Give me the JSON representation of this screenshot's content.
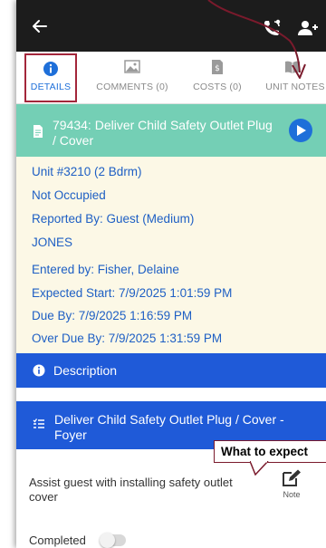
{
  "colors": {
    "topbar": "#1c1c1c",
    "accent_blue": "#1e6fd9",
    "header_teal": "#74cfb5",
    "details_bg": "#fcf8e6",
    "section_blue": "#1f5ad8",
    "annotation": "#7a1a2c"
  },
  "topbar": {
    "back_icon": "arrow-left-icon",
    "call_icon": "phone-call-icon",
    "add_person_icon": "person-add-icon"
  },
  "tabs": [
    {
      "label": "DETAILS",
      "icon": "info-circle-icon",
      "active": true
    },
    {
      "label": "COMMENTS (0)",
      "icon": "image-icon",
      "active": false
    },
    {
      "label": "COSTS (0)",
      "icon": "receipt-dollar-icon",
      "active": false
    },
    {
      "label": "UNIT NOTES",
      "icon": "book-open-icon",
      "active": false
    }
  ],
  "work_order": {
    "title": "79434: Deliver Child Safety Outlet Plug / Cover",
    "details": {
      "unit": "Unit #3210 (2 Bdrm)",
      "occupancy": "Not Occupied",
      "reported_by": "Reported By: Guest  (Medium)",
      "reporter_name": "JONES",
      "entered_by": "Entered by: Fisher, Delaine",
      "expected_start": "Expected Start: 7/9/2025 1:01:59 PM",
      "due_by": "Due By: 7/9/2025 1:16:59 PM",
      "over_due_by": "Over Due By: 7/9/2025 1:31:59 PM"
    }
  },
  "description": {
    "label": "Description"
  },
  "task": {
    "title": "Deliver Child Safety Outlet Plug / Cover - Foyer",
    "text": "Assist guest with installing safety outlet cover",
    "note_label": "Note",
    "completed_label": "Completed",
    "completed": false
  },
  "callout": {
    "text": "What to expect"
  }
}
